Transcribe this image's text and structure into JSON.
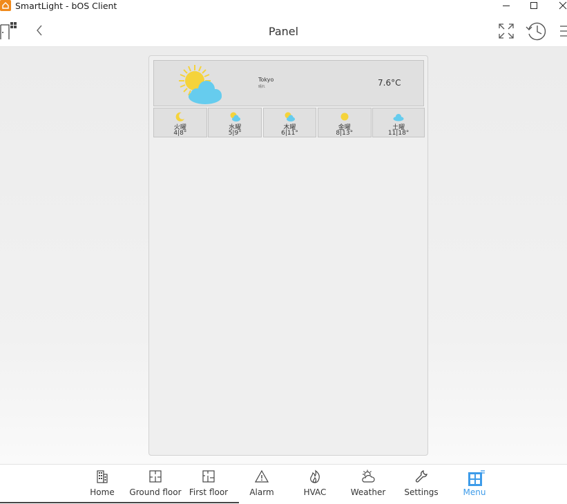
{
  "window": {
    "title": "SmartLight - bOS Client"
  },
  "header": {
    "title": "Panel"
  },
  "weather": {
    "city": "Tokyo",
    "condition": "晴れ",
    "temperature": "7.6°C",
    "icon": "partly-cloudy-icon",
    "forecast": [
      {
        "day": "火曜",
        "temps": "4|8°",
        "icon": "moon-icon"
      },
      {
        "day": "水曜",
        "temps": "5|9°",
        "icon": "sun-cloud-icon"
      },
      {
        "day": "木曜",
        "temps": "6|11°",
        "icon": "sun-cloud-icon"
      },
      {
        "day": "金曜",
        "temps": "8|13°",
        "icon": "sun-icon"
      },
      {
        "day": "土曜",
        "temps": "11|18°",
        "icon": "cloud-icon"
      }
    ]
  },
  "nav": {
    "items": [
      {
        "label": "Home",
        "icon": "building-icon"
      },
      {
        "label": "Ground floor",
        "icon": "floor-plan-icon"
      },
      {
        "label": "First floor",
        "icon": "floor-plan-icon"
      },
      {
        "label": "Alarm",
        "icon": "alarm-icon"
      },
      {
        "label": "HVAC",
        "icon": "flame-icon"
      },
      {
        "label": "Weather",
        "icon": "weather-icon"
      },
      {
        "label": "Settings",
        "icon": "wrench-icon"
      },
      {
        "label": "Menu",
        "icon": "menu-grid-icon",
        "active": true
      }
    ]
  },
  "colors": {
    "accent": "#3d9be9",
    "app_icon": "#f08a1c",
    "sun": "#f5d33b",
    "cloud": "#66ccee"
  }
}
